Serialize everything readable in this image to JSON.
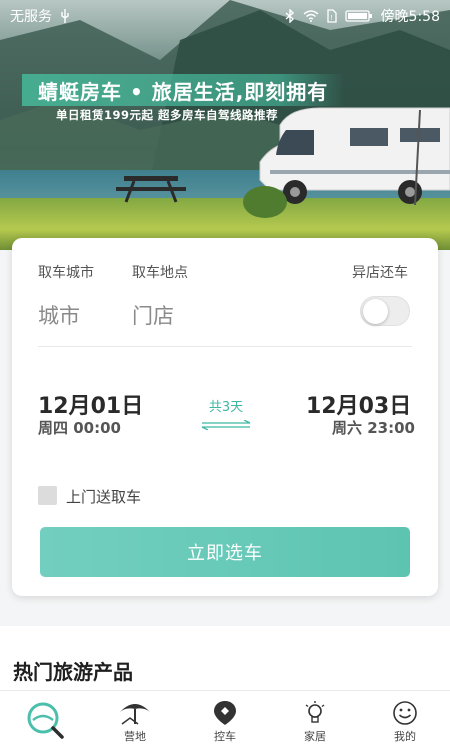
{
  "status_bar": {
    "carrier": "无服务",
    "time": "傍晚5:58",
    "icons": [
      "usb-icon",
      "bluetooth-icon",
      "wifi-icon",
      "sim-icon",
      "battery-icon"
    ]
  },
  "banner": {
    "title": "蜻蜓房车 • 旅居生活,即刻拥有",
    "subtitle": "单日租赁199元起 超多房车自驾线路推荐"
  },
  "booking": {
    "pickup_city_label": "取车城市",
    "pickup_city_placeholder": "城市",
    "pickup_store_label": "取车地点",
    "pickup_store_placeholder": "门店",
    "return_other_label": "异店还车",
    "return_other_enabled": false,
    "start_date": "12月01日",
    "start_time": "周四 00:00",
    "duration": "共3天",
    "end_date": "12月03日",
    "end_time": "周六 23:00",
    "door_delivery_label": "上门送取车",
    "door_delivery_checked": false,
    "select_button": "立即选车"
  },
  "hot_products": {
    "title": "热门旅游产品"
  },
  "bottom_nav": {
    "items": [
      {
        "label": "",
        "icon": "search-icon"
      },
      {
        "label": "营地",
        "icon": "campsite-icon"
      },
      {
        "label": "控车",
        "icon": "car-control-icon"
      },
      {
        "label": "家居",
        "icon": "home-bulb-icon"
      },
      {
        "label": "我的",
        "icon": "smiley-icon"
      }
    ]
  },
  "colors": {
    "accent": "#5ec4b2",
    "accent_text": "#3fb9a4"
  }
}
